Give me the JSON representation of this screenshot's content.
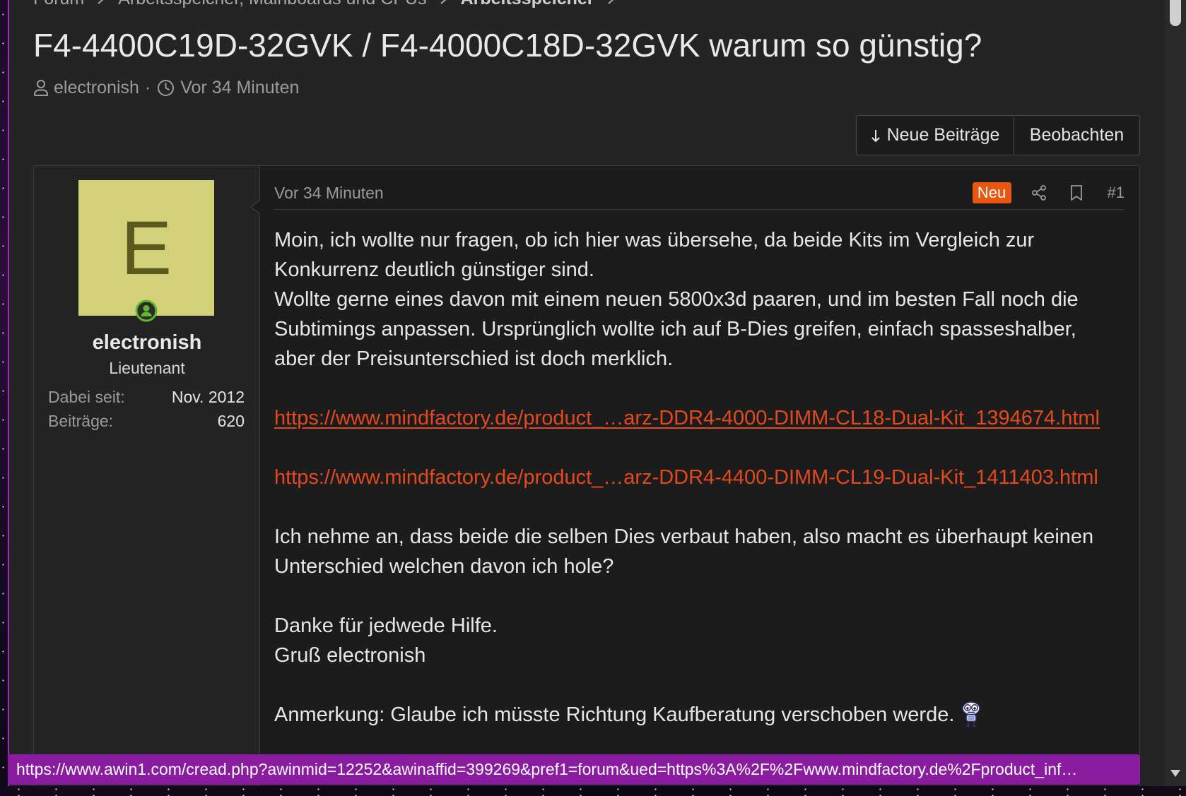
{
  "breadcrumb": {
    "items": [
      {
        "label": "Forum"
      },
      {
        "label": "Arbeitsspeicher, Mainboards und CPUs"
      },
      {
        "label": "Arbeitsspeicher"
      }
    ]
  },
  "thread": {
    "title": "F4-4400C19D-32GVK / F4-4000C18D-32GVK warum so günstig?",
    "author": "electronish",
    "separator": "·",
    "time": "Vor 34 Minuten"
  },
  "actions": {
    "new_posts_label": "Neue Beiträge",
    "watch_label": "Beobachten"
  },
  "post": {
    "user": {
      "avatar_letter": "E",
      "online": true,
      "name": "electronish",
      "rank": "Lieutenant",
      "stats": [
        {
          "label": "Dabei seit:",
          "value": "Nov. 2012"
        },
        {
          "label": "Beiträge:",
          "value": "620"
        }
      ]
    },
    "time": "Vor 34 Minuten",
    "badge": "Neu",
    "number": "#1",
    "body": {
      "intro_lines": [
        "Moin, ich wollte nur fragen, ob ich hier was übersehe, da beide Kits im Vergleich zur",
        "Konkurrenz deutlich günstiger sind.",
        "Wollte gerne eines davon mit einem neuen 5800x3d paaren, und im besten Fall noch die",
        "Subtimings anpassen. Ursprünglich wollte ich auf B-Dies greifen, einfach spasseshalber,",
        "aber der Preisunterschied ist doch merklich."
      ],
      "links": [
        "https://www.mindfactory.de/product_…arz-DDR4-4000-DIMM-CL18-Dual-Kit_1394674.html",
        "https://www.mindfactory.de/product_…arz-DDR4-4400-DIMM-CL19-Dual-Kit_1411403.html"
      ],
      "question_lines": [
        "Ich nehme an, dass beide die selben Dies verbaut haben, also macht es überhaupt keinen",
        "Unterschied welchen davon ich hole?"
      ],
      "closing_lines": [
        "Danke für jedwede Hilfe.",
        "Gruß electronish"
      ],
      "note": "Anmerkung: Glaube ich müsste Richtung Kaufberatung verschoben werde."
    }
  },
  "status_bar": {
    "url": "https://www.awin1.com/cread.php?awinmid=12252&awinaffid=399269&pref1=forum&ued=https%3A%2F%2Fwww.mindfactory.de%2Fproduct_inf…"
  },
  "icons": {
    "meta_author": "user-icon",
    "meta_time": "clock-icon",
    "breadcrumb_separator": "chevron-right-icon",
    "new_posts": "arrow-down-icon",
    "share": "share-icon",
    "bookmark": "bookmark-icon",
    "online": "online-indicator-icon",
    "smilie": "smilie-icon",
    "scroll_down": "scroll-down-arrow-icon"
  },
  "colors": {
    "page_background": "#242424",
    "avatar_background": "#d3d07a",
    "avatar_letter": "#5b5a1e",
    "link": "#e4491e",
    "badge_new": "#e8560f",
    "online": "#5fb82e",
    "status_bar": "#8a1c9f",
    "window_border": "#a427c2"
  }
}
